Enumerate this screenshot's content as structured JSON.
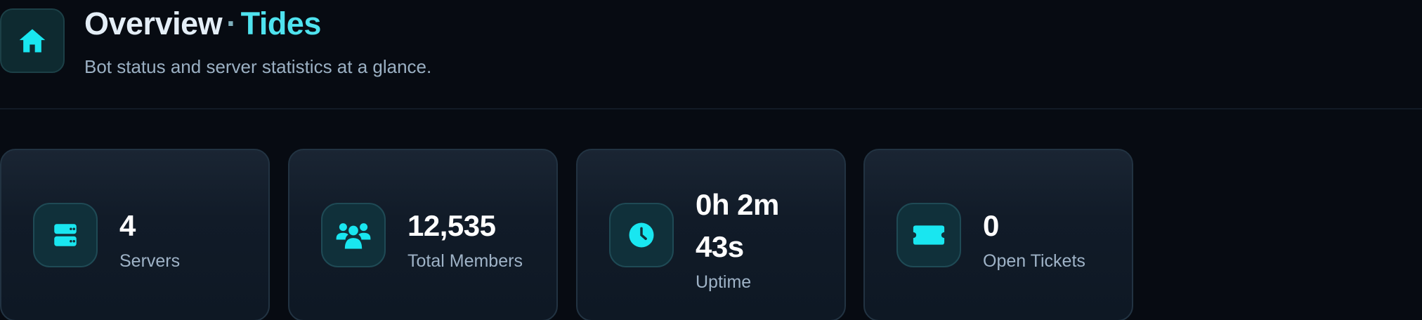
{
  "header": {
    "title_main": "Overview",
    "title_sep": "·",
    "title_bot": "Tides",
    "subtitle": "Bot status and server statistics at a glance.",
    "icon": "home-icon"
  },
  "colors": {
    "accent": "#4fe3ef",
    "icon_cyan": "#19e6f0",
    "background": "#070b12",
    "card_border": "#223342"
  },
  "stats": [
    {
      "value": "4",
      "label": "Servers",
      "icon": "server-icon"
    },
    {
      "value": "12,535",
      "label": "Total Members",
      "icon": "users-icon"
    },
    {
      "value": "0h 2m 43s",
      "label": "Uptime",
      "icon": "clock-icon"
    },
    {
      "value": "0",
      "label": "Open Tickets",
      "icon": "ticket-icon"
    }
  ]
}
